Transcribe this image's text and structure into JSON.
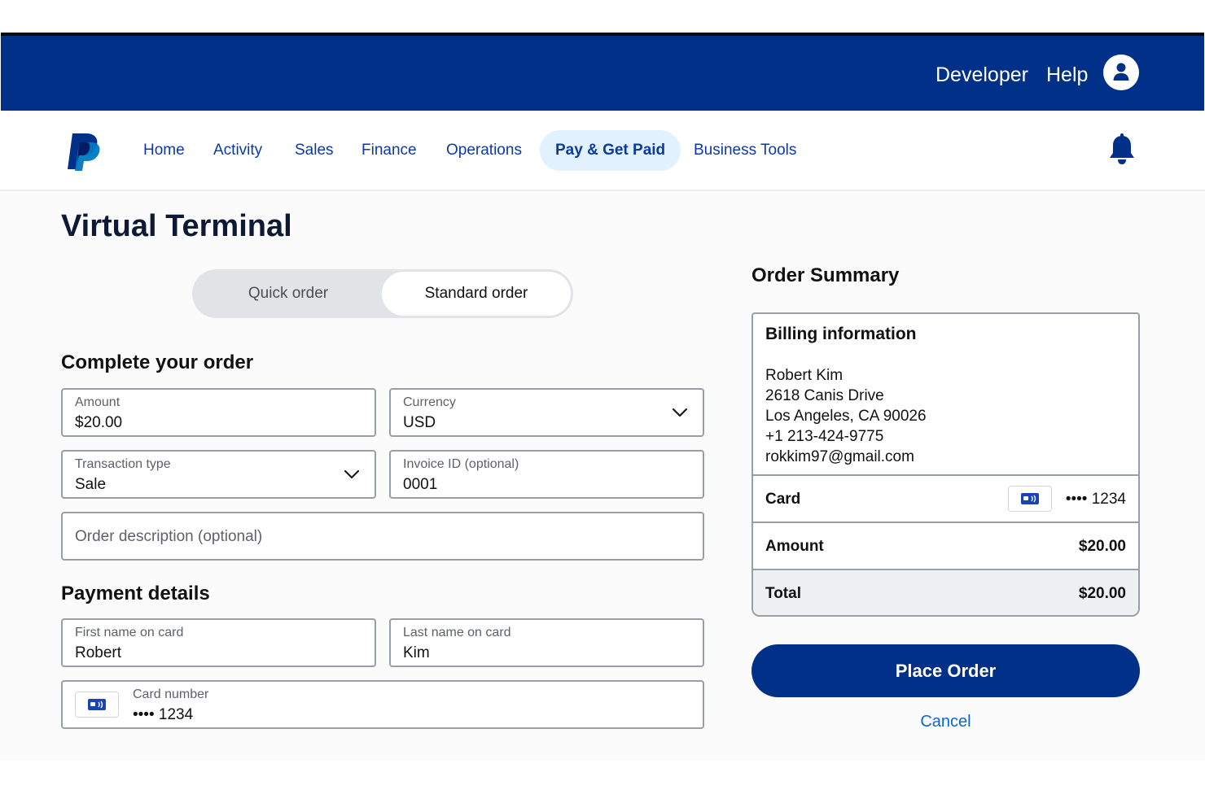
{
  "topbar": {
    "developer_label": "Developer",
    "help_label": "Help",
    "avatar_icon": "user-icon"
  },
  "nav": {
    "logo_icon": "paypal-logo",
    "items": [
      {
        "label": "Home"
      },
      {
        "label": "Activity"
      },
      {
        "label": "Sales"
      },
      {
        "label": "Finance"
      },
      {
        "label": "Operations"
      },
      {
        "label": "Pay & Get Paid",
        "active": true
      },
      {
        "label": "Business Tools"
      }
    ],
    "notification_icon": "bell-icon"
  },
  "page": {
    "title": "Virtual Terminal"
  },
  "order_type": {
    "options": [
      "Quick order",
      "Standard order"
    ],
    "selected": "Standard order"
  },
  "complete_order": {
    "title": "Complete your order",
    "amount": {
      "label": "Amount",
      "value": "$20.00"
    },
    "currency": {
      "label": "Currency",
      "value": "USD"
    },
    "transaction_type": {
      "label": "Transaction type",
      "value": "Sale"
    },
    "invoice_id": {
      "label": "Invoice ID (optional)",
      "value": "0001"
    },
    "order_description": {
      "placeholder": "Order description (optional)"
    }
  },
  "payment": {
    "title": "Payment details",
    "first_name": {
      "label": "First name on card",
      "value": "Robert"
    },
    "last_name": {
      "label": "Last name on card",
      "value": "Kim"
    },
    "card_number": {
      "label": "Card number",
      "value": "•••• 1234"
    }
  },
  "summary": {
    "title": "Order Summary",
    "billing": {
      "title": "Billing information",
      "lines": [
        "Robert Kim",
        "2618 Canis Drive",
        "Los Angeles, CA 90026",
        "+1 213-424-9775",
        "rokkim97@gmail.com"
      ]
    },
    "card": {
      "label": "Card",
      "value": "•••• 1234"
    },
    "amount": {
      "label": "Amount",
      "value": "$20.00"
    },
    "total": {
      "label": "Total",
      "value": "$20.00"
    },
    "place_order_label": "Place Order",
    "cancel_label": "Cancel"
  },
  "colors": {
    "brand_navy": "#003087",
    "nav_link": "#0c3aa0",
    "active_pill": "#e1f1fd",
    "cancel_link": "#0a67cc"
  }
}
